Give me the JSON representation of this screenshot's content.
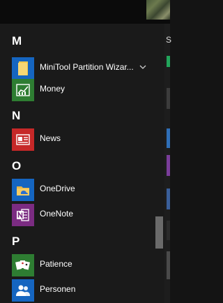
{
  "start_menu": {
    "sections": [
      {
        "letter": "M",
        "apps": [
          {
            "label": "MiniTool Partition Wizar...",
            "icon": "folder-icon",
            "tile_color": "#1565c0",
            "has_chevron": true
          },
          {
            "label": "Money",
            "icon": "chart-icon",
            "tile_color": "#2e7d32"
          }
        ]
      },
      {
        "letter": "N",
        "apps": [
          {
            "label": "News",
            "icon": "newspaper-icon",
            "tile_color": "#c62828"
          }
        ]
      },
      {
        "letter": "O",
        "apps": [
          {
            "label": "OneDrive",
            "icon": "onedrive-folder-icon",
            "tile_color": "#1565c0"
          },
          {
            "label": "OneNote",
            "icon": "onenote-icon",
            "tile_color": "#7b2c82"
          }
        ]
      },
      {
        "letter": "P",
        "apps": [
          {
            "label": "Patience",
            "icon": "cards-icon",
            "tile_color": "#2e7d32"
          },
          {
            "label": "Personen",
            "icon": "people-icon",
            "tile_color": "#1565c0"
          }
        ]
      }
    ]
  },
  "right_pane": {
    "header_fragment": "S"
  }
}
